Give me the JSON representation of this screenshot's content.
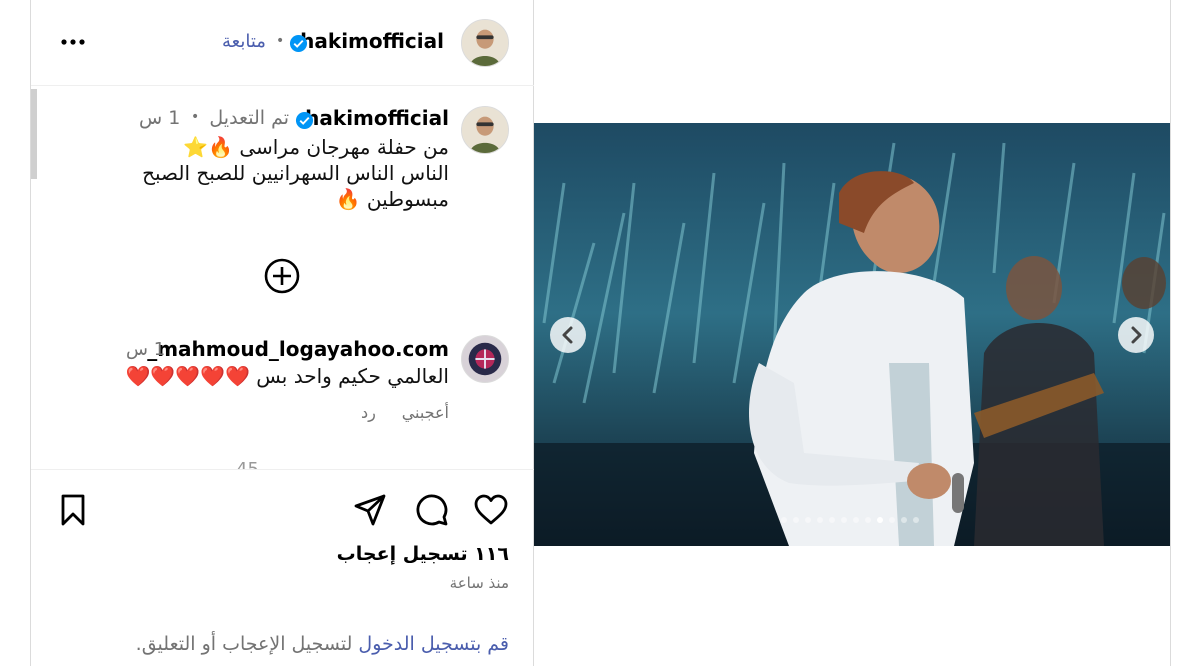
{
  "header": {
    "username": "hakimofficial",
    "follow_label": "متابعة",
    "separator": "•"
  },
  "caption": {
    "username": "hakimofficial",
    "edited_label": "تم التعديل",
    "separator": "•",
    "time": "1 س",
    "lines": [
      "من حفلة مهرجان مراسى 🔥⭐",
      "الناس الناس السهرانيين للصبح الصبح",
      "مبسوطين 🔥"
    ]
  },
  "comment": {
    "username": "_mahmoud_logayahoo.com",
    "time": "1 س",
    "text": "العالمي حكيم واحد بس ❤️❤️❤️❤️❤️",
    "like_label": "أعجبني",
    "reply_label": "رد"
  },
  "partial_comment_time": "45",
  "actions": {
    "likes_text": "١١٦ تسجيل إعجاب",
    "since_text": "منذ ساعة"
  },
  "login_prompt": {
    "link": "قم بتسجيل الدخول",
    "rest": " لتسجيل الإعجاب أو التعليق."
  },
  "carousel": {
    "total_slides": 12,
    "active_index": 8
  },
  "colors": {
    "link": "#4a5dad",
    "verified": "#0095f6",
    "secondary_text": "#737373"
  }
}
